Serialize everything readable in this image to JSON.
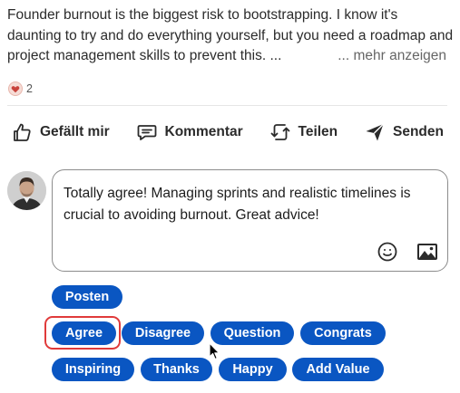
{
  "post": {
    "text": "Founder burnout is the biggest risk to bootstrapping. I know it's daunting to try and do everything yourself, but you need a roadmap and project management skills to prevent this. ...",
    "more_label": "... mehr anzeigen"
  },
  "reactions": {
    "count": "2",
    "icon": "heart-reaction-icon"
  },
  "actions": [
    {
      "label": "Gefällt mir",
      "icon": "thumbs-up-icon"
    },
    {
      "label": "Kommentar",
      "icon": "comment-icon"
    },
    {
      "label": "Teilen",
      "icon": "repost-icon"
    },
    {
      "label": "Senden",
      "icon": "send-icon"
    }
  ],
  "comment": {
    "value": "Totally agree! Managing sprints and realistic timelines is crucial to avoiding burnout. Great advice!",
    "emoji_icon": "emoji-icon",
    "image_icon": "image-icon"
  },
  "post_button": "Posten",
  "suggestions": {
    "row1": [
      "Agree",
      "Disagree",
      "Question",
      "Congrats"
    ],
    "row2": [
      "Inspiring",
      "Thanks",
      "Happy",
      "Add Value"
    ]
  },
  "colors": {
    "pill": "#0a56c2",
    "highlight": "#e03a3a",
    "heart": "#c8433c"
  }
}
